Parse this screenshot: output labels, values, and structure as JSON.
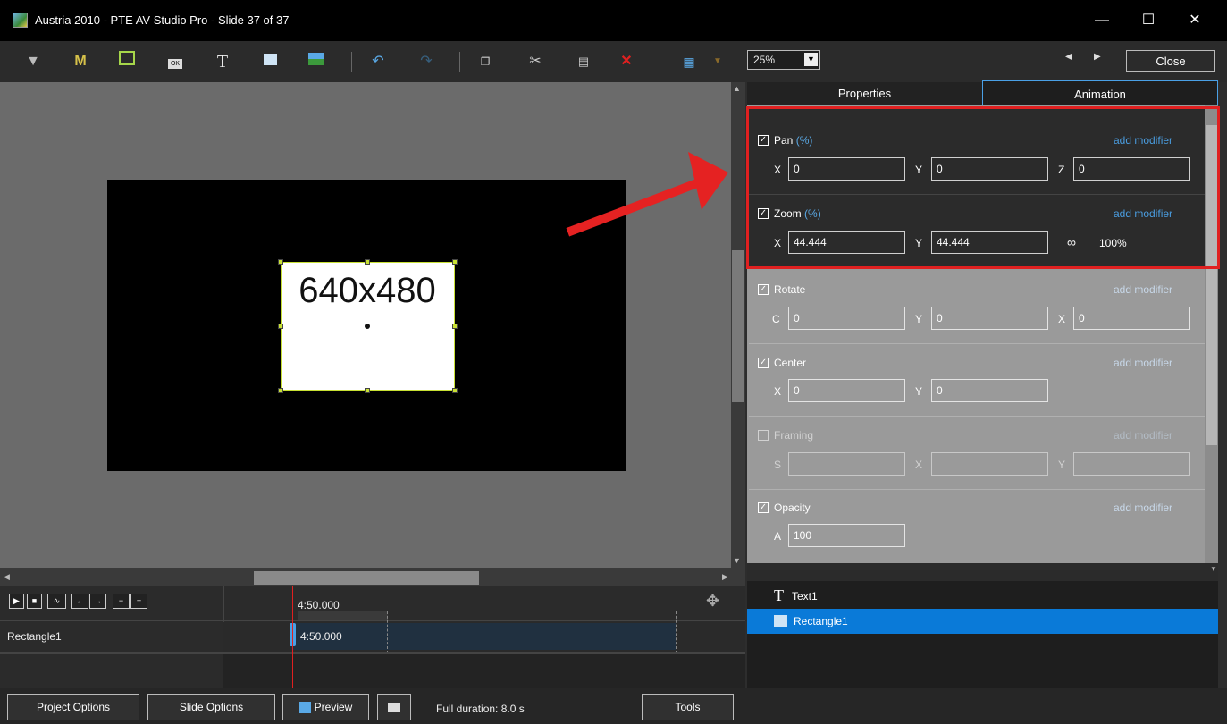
{
  "window": {
    "title": "Austria 2010 - PTE AV Studio Pro - Slide 37 of 37",
    "minimize": "—",
    "maximize": "☐",
    "close": "✕"
  },
  "toolbar": {
    "zoom": "25%",
    "close_label": "Close",
    "nav_prev": "◀",
    "nav_next": "▶"
  },
  "canvas": {
    "rect_label": "640x480"
  },
  "tabs": {
    "properties": "Properties",
    "animation": "Animation"
  },
  "animation": {
    "add_modifier": "add modifier",
    "pan": {
      "label": "Pan",
      "unit": "(%)",
      "x_label": "X",
      "x": "0",
      "y_label": "Y",
      "y": "0",
      "z_label": "Z",
      "z": "0"
    },
    "zoom": {
      "label": "Zoom",
      "unit": "(%)",
      "x_label": "X",
      "x": "44.444",
      "y_label": "Y",
      "y": "44.444",
      "link_pct": "100%"
    },
    "rotate": {
      "label": "Rotate",
      "c_label": "C",
      "c": "0",
      "y_label": "Y",
      "y": "0",
      "x_label": "X",
      "x": "0"
    },
    "center": {
      "label": "Center",
      "x_label": "X",
      "x": "0",
      "y_label": "Y",
      "y": "0"
    },
    "framing": {
      "label": "Framing",
      "s_label": "S",
      "x_label": "X",
      "y_label": "Y"
    },
    "opacity": {
      "label": "Opacity",
      "a_label": "A",
      "a": "100"
    }
  },
  "objects": [
    {
      "icon": "T",
      "name": "Text1"
    },
    {
      "icon": "rect",
      "name": "Rectangle1"
    }
  ],
  "timeline": {
    "time": "4:50.000",
    "row_label": "Rectangle1",
    "clip_time": "4:50.000"
  },
  "bottom": {
    "project_options": "Project Options",
    "slide_options": "Slide Options",
    "preview": "Preview",
    "full_duration": "Full duration: 8.0 s",
    "tools": "Tools"
  },
  "colors": {
    "accent": "#4a9de0",
    "highlight": "#e02020",
    "selection": "#0a7ad8"
  }
}
